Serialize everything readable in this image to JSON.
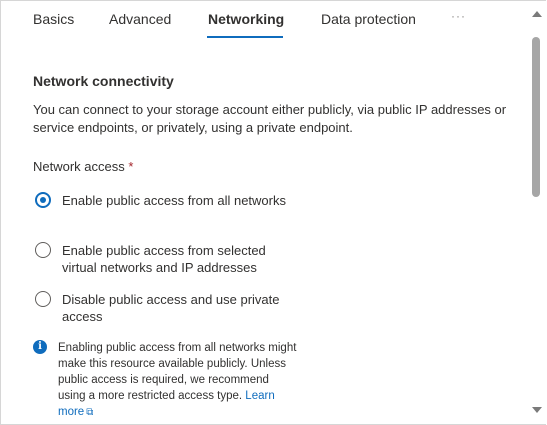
{
  "tabs": [
    {
      "label": "Basics",
      "active": false
    },
    {
      "label": "Advanced",
      "active": false
    },
    {
      "label": "Networking",
      "active": true
    },
    {
      "label": "Data protection",
      "active": false
    }
  ],
  "tabs_more": "···",
  "section": {
    "title": "Network connectivity",
    "description": "You can connect to your storage account either publicly, via public IP addresses or service endpoints, or privately, using a private endpoint."
  },
  "network_access": {
    "label": "Network access",
    "required_marker": "*",
    "selected_index": 0,
    "options": [
      {
        "label": "Enable public access from all networks"
      },
      {
        "label": "Enable public access from selected virtual networks and IP addresses"
      },
      {
        "label": "Disable public access and use private access"
      }
    ]
  },
  "info": {
    "icon": "info-icon",
    "text": "Enabling public access from all networks might make this resource available publicly. Unless public access is required, we recommend using a more restricted access type.",
    "link_text": "Learn more",
    "link_icon": "external-link-icon"
  },
  "colors": {
    "accent": "#0f6cbd",
    "text": "#323130",
    "required": "#a4262c"
  }
}
